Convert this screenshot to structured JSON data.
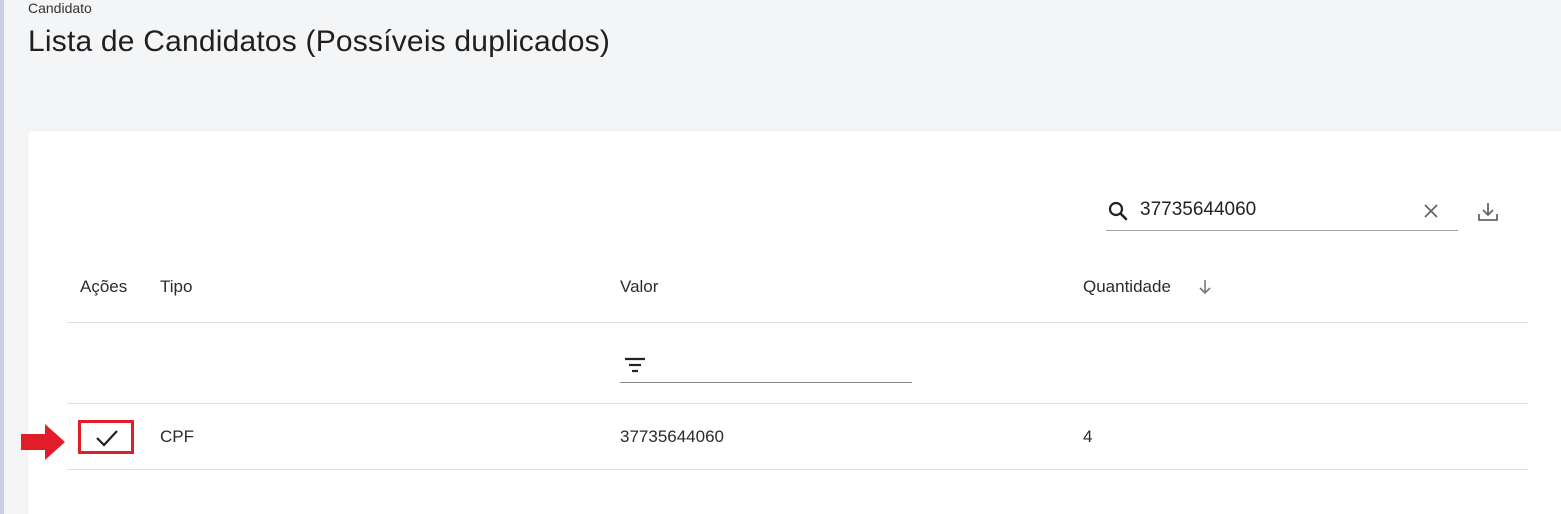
{
  "header": {
    "breadcrumb": "Candidato",
    "title": "Lista de Candidatos (Possíveis duplicados)"
  },
  "search": {
    "value": "37735644060",
    "icon": "search-icon",
    "clear_icon": "close-icon"
  },
  "toolbar": {
    "download_icon": "download-icon"
  },
  "table": {
    "columns": [
      "Ações",
      "Tipo",
      "Valor",
      "Quantidade"
    ],
    "sort": {
      "column": "Quantidade",
      "direction": "desc"
    },
    "filter": {
      "column": "Valor",
      "value": ""
    },
    "rows": [
      {
        "tipo": "CPF",
        "valor": "37735644060",
        "quantidade": "4",
        "action_icon": "check-icon"
      }
    ]
  },
  "annotations": {
    "highlight_color": "#e11d2a",
    "arrow_icon": "arrow-right-icon"
  }
}
